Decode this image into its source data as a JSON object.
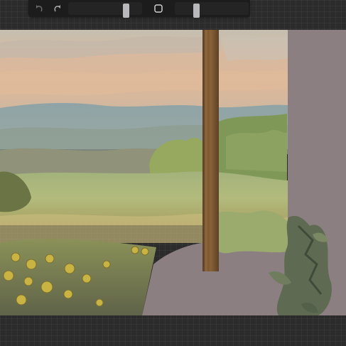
{
  "app": {
    "name": "painting-app"
  },
  "toolbar": {
    "undo_icon": "undo-icon",
    "redo_icon": "redo-icon",
    "modify_icon": "square-modify-icon",
    "brush_size_level": 0.81,
    "opacity_level": 0.27
  },
  "canvas": {
    "subject": "landscape-painting"
  },
  "colors": {
    "background": "#2b2b2c",
    "toolbar": "#1c1c1d",
    "slider_thumb": "#b9b9bb",
    "wall": "#8c7f82",
    "post": "#7a5532",
    "sky_warm": "#d9b89a",
    "sunflower": "#c9b443"
  }
}
